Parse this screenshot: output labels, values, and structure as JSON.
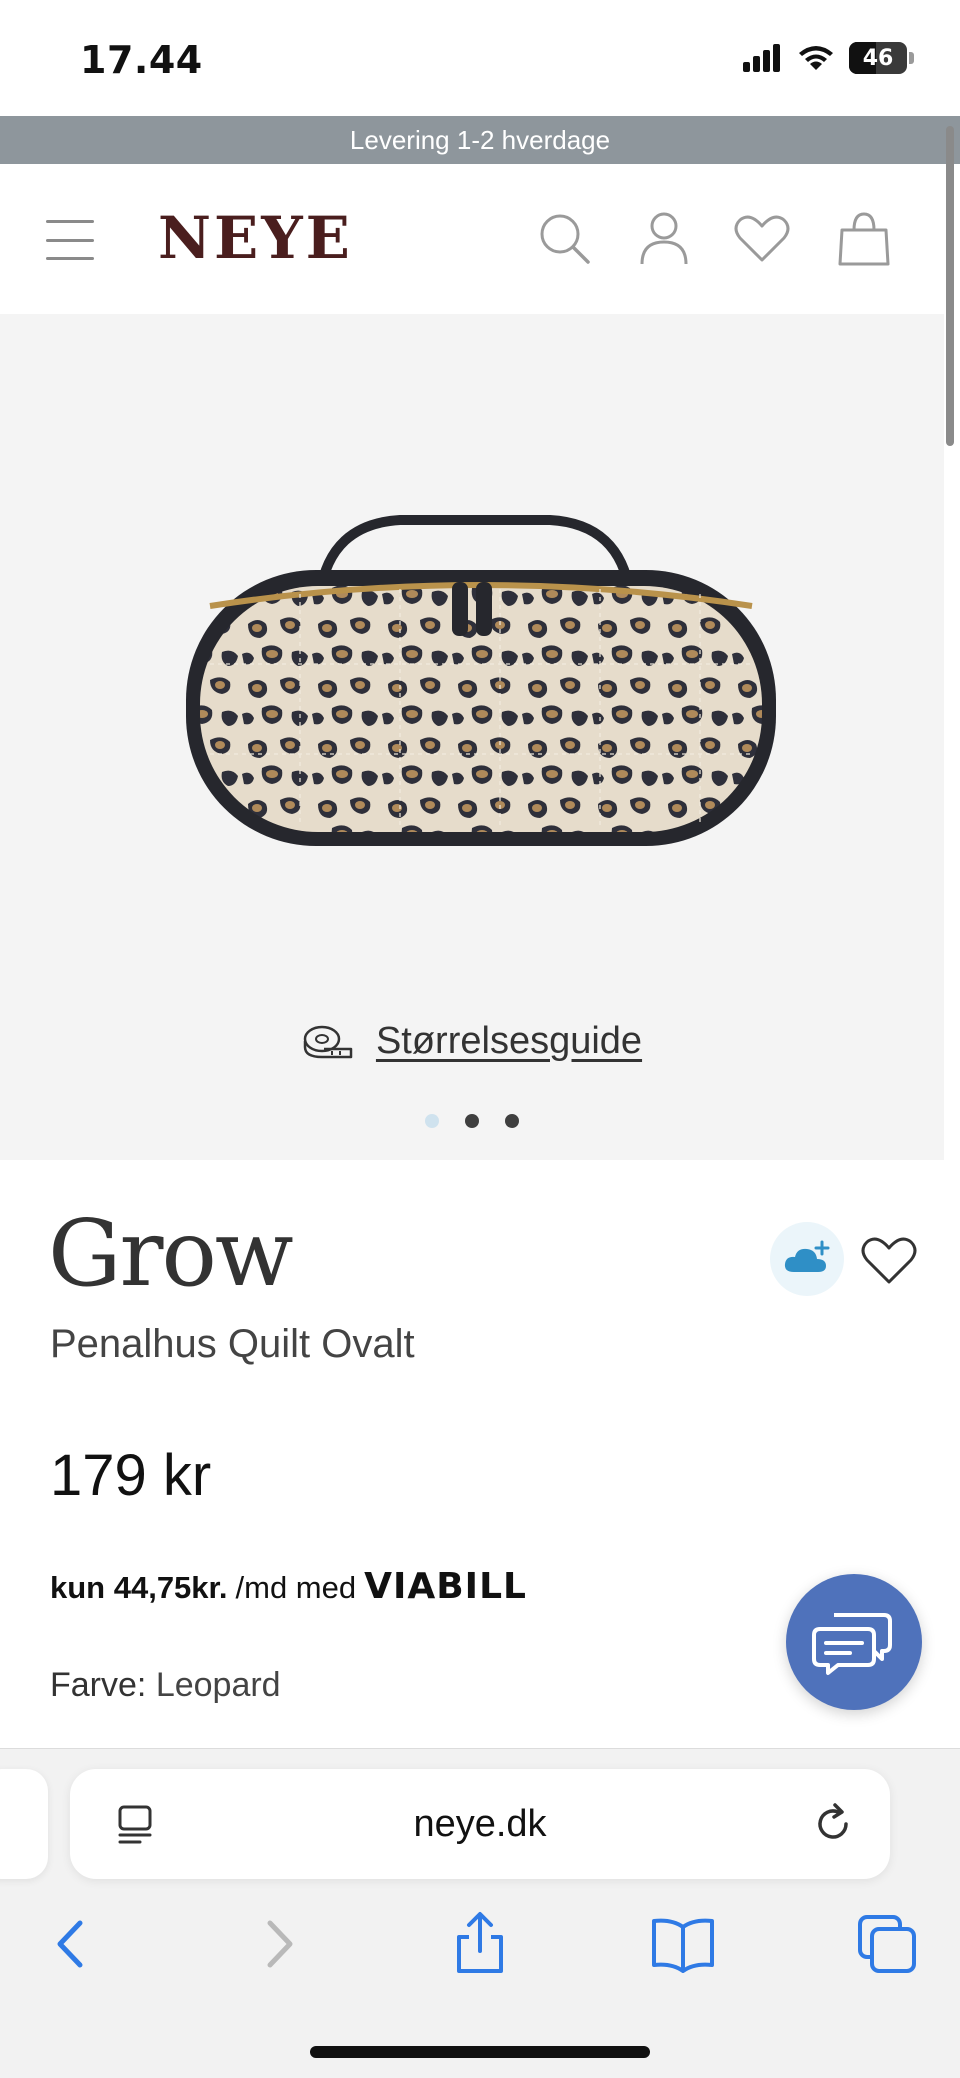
{
  "status_bar": {
    "time": "17.44",
    "battery": "46",
    "battery_level": 0.46
  },
  "promo": {
    "text": "Levering 1-2 hverdage"
  },
  "header": {
    "logo": "NEYE",
    "icons": [
      "menu-icon",
      "search-icon",
      "account-icon",
      "heart-icon",
      "shopping-bag-icon"
    ]
  },
  "gallery": {
    "size_guide_label": "Størrelsesguide",
    "image_count": 3,
    "active_image": 1
  },
  "product": {
    "brand": "Grow",
    "name": "Penalhus Quilt Ovalt",
    "price": "179 kr",
    "installment": {
      "amount": "kun 44,75kr.",
      "suffix": "/md med",
      "provider": "VIABILL"
    },
    "color_label": "Farve:",
    "color_value": "Leopard"
  },
  "safari": {
    "url": "neye.dk",
    "toolbar_icons": [
      "back-icon",
      "forward-icon",
      "share-icon",
      "bookmarks-icon",
      "tabs-icon"
    ]
  },
  "colors": {
    "accent_blue": "#4f72bb",
    "logo_brown": "#4a1e1e",
    "promo_gray": "#8e969c",
    "safari_blue": "#2f7ae5"
  }
}
